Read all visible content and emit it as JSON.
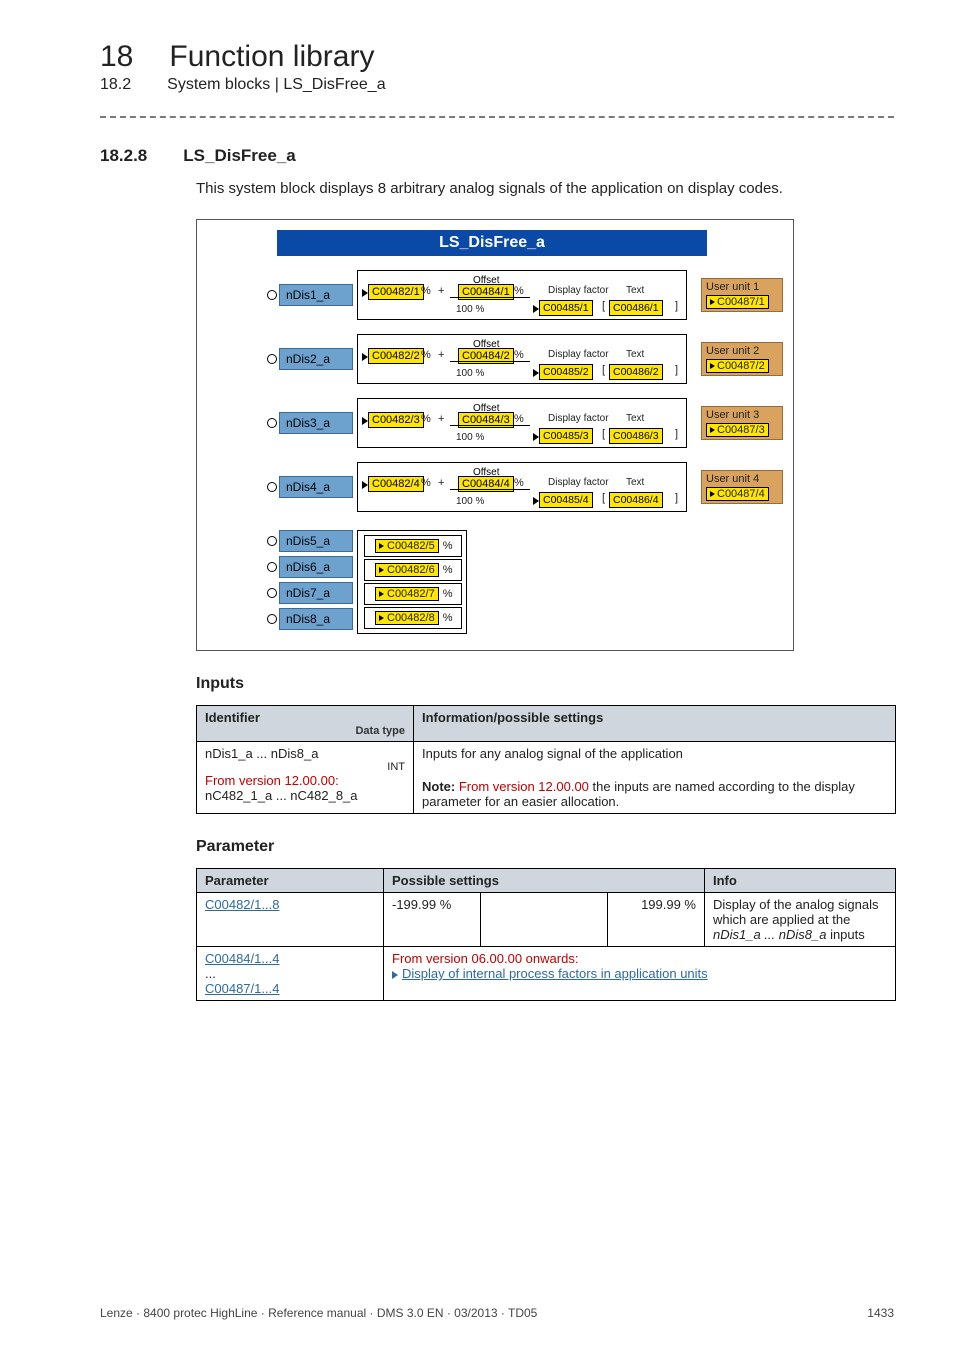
{
  "header": {
    "chapter_num": "18",
    "chapter_title": "Function library",
    "sub_num": "18.2",
    "sub_title": "System blocks | LS_DisFree_a"
  },
  "section": {
    "num": "18.2.8",
    "title": "LS_DisFree_a",
    "intro": "This system block displays 8 arbitrary analog signals of the application on display codes."
  },
  "diagram": {
    "title": "LS_DisFree_a",
    "offset_label": "Offset",
    "display_factor_label": "Display factor",
    "text_label": "Text",
    "plus": "% +",
    "pct_only": "%",
    "hundred": "100 %",
    "rows": [
      {
        "input": "nDis1_a",
        "c1": "C00482/1",
        "c2": "C00484/1",
        "c3": "C00485/1",
        "c4": "C00486/1",
        "unit_label": "User unit 1",
        "unit_code": "C00487/1"
      },
      {
        "input": "nDis2_a",
        "c1": "C00482/2",
        "c2": "C00484/2",
        "c3": "C00485/2",
        "c4": "C00486/2",
        "unit_label": "User unit 2",
        "unit_code": "C00487/2"
      },
      {
        "input": "nDis3_a",
        "c1": "C00482/3",
        "c2": "C00484/3",
        "c3": "C00485/3",
        "c4": "C00486/3",
        "unit_label": "User unit 3",
        "unit_code": "C00487/3"
      },
      {
        "input": "nDis4_a",
        "c1": "C00482/4",
        "c2": "C00484/4",
        "c3": "C00485/4",
        "c4": "C00486/4",
        "unit_label": "User unit 4",
        "unit_code": "C00487/4"
      }
    ],
    "small_rows": [
      {
        "input": "nDis5_a",
        "code": "C00482/5"
      },
      {
        "input": "nDis6_a",
        "code": "C00482/6"
      },
      {
        "input": "nDis7_a",
        "code": "C00482/7"
      },
      {
        "input": "nDis8_a",
        "code": "C00482/8"
      }
    ],
    "pct_suffix": "%"
  },
  "inputs": {
    "heading": "Inputs",
    "th_identifier": "Identifier",
    "th_info": "Information/possible settings",
    "data_type_label": "Data type",
    "row1_id_line1": "nDis1_a ... nDis8_a",
    "row1_int": "INT",
    "row1_from": "From version 12.00.00:",
    "row1_id_line3": "nC482_1_a ... nC482_8_a",
    "row1_info_line1": "Inputs for any analog signal of the application",
    "row1_note_prefix": "Note: ",
    "row1_note_red": "From version 12.00.00",
    "row1_note_suffix": " the inputs are named according to the display parameter for an easier allocation."
  },
  "params": {
    "heading": "Parameter",
    "th_param": "Parameter",
    "th_settings": "Possible settings",
    "th_info": "Info",
    "r1_param": "C00482/1...8",
    "r1_low": "-199.99 %",
    "r1_high": "199.99 %",
    "r1_info_1": "Display of the analog signals which are applied at the ",
    "r1_info_italic": "nDis1_a ... nDis8_a",
    "r1_info_2": " inputs",
    "r2_a": "C00484/1...4",
    "r2_dots": "...",
    "r2_b": "C00487/1...4",
    "r2_from": "From version 06.00.00 onwards:",
    "r2_link": "Display of internal process factors in application units"
  },
  "footer": {
    "left": "Lenze · 8400 protec HighLine · Reference manual · DMS 3.0 EN · 03/2013 · TD05",
    "right": "1433"
  }
}
